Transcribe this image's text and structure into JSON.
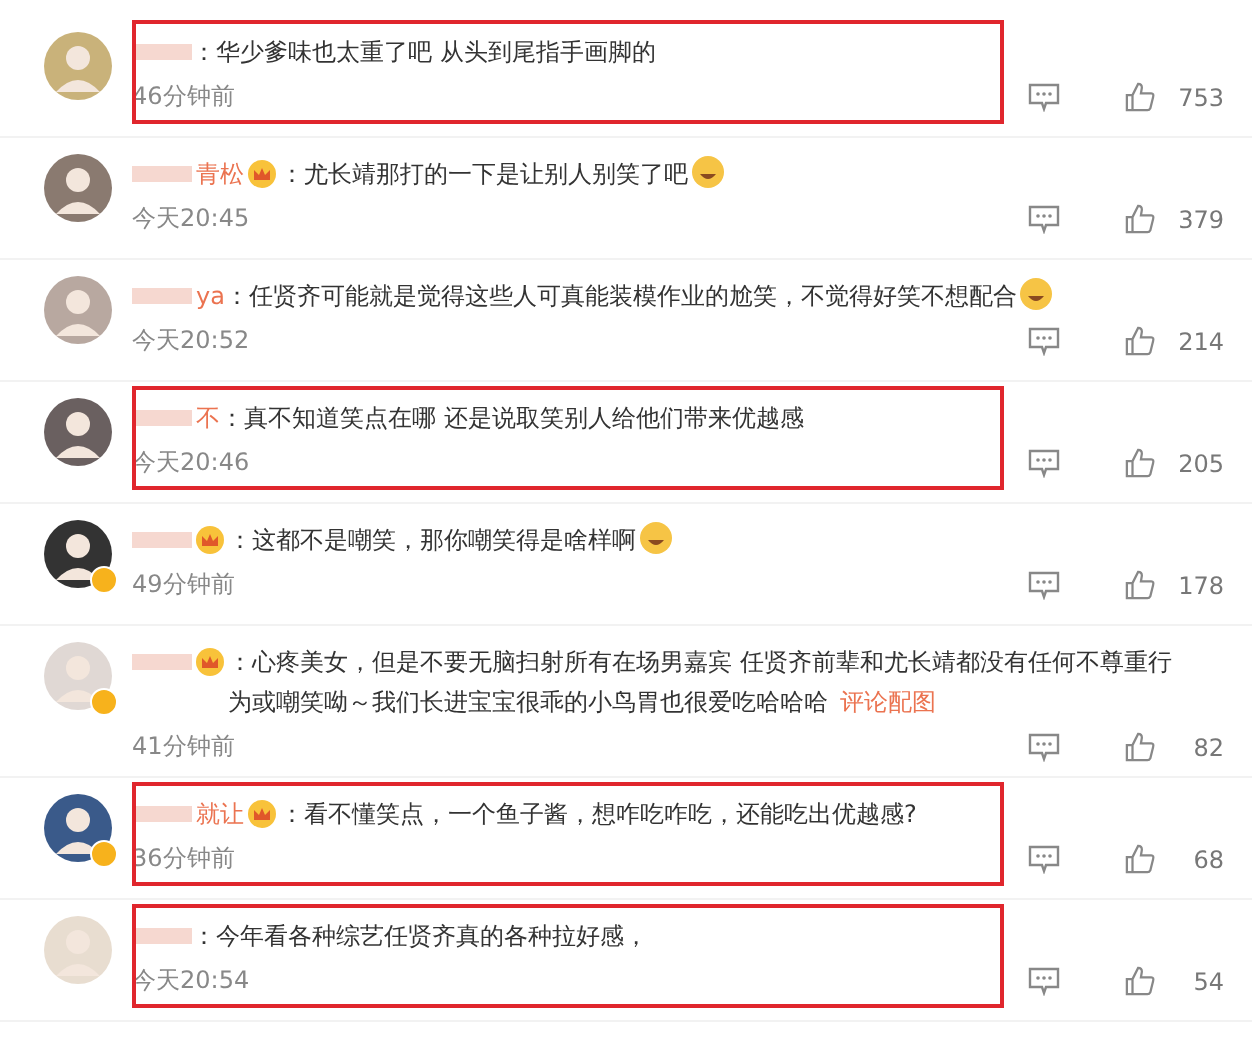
{
  "comments": [
    {
      "crown": false,
      "verified": false,
      "text": "：华少爹味也太重了吧 从头到尾指手画脚的",
      "emoji": false,
      "time": "46分钟前",
      "likes": "753",
      "highlighted": true
    },
    {
      "name": "青松",
      "crown": true,
      "verified": false,
      "text": "：尤长靖那打的一下是让别人别笑了吧",
      "emoji": true,
      "time": "今天20:45",
      "likes": "379",
      "highlighted": false
    },
    {
      "name": "ya",
      "crown": false,
      "verified": false,
      "text": "：任贤齐可能就是觉得这些人可真能装模作业的尬笑，不觉得好笑不想配合",
      "emoji": true,
      "time": "今天20:52",
      "likes": "214",
      "highlighted": false
    },
    {
      "name": "不",
      "crown": false,
      "verified": false,
      "text": "：真不知道笑点在哪 还是说取笑别人给他们带来优越感",
      "emoji": false,
      "time": "今天20:46",
      "likes": "205",
      "highlighted": true
    },
    {
      "crown": true,
      "verified": true,
      "text": "：这都不是嘲笑，那你嘲笑得是啥样啊",
      "emoji": true,
      "time": "49分钟前",
      "likes": "178",
      "highlighted": false
    },
    {
      "crown": true,
      "verified": true,
      "text": "：心疼美女，但是不要无脑扫射所有在场男嘉宾 任贤齐前辈和尤长靖都没有任何不尊重行为或嘲笑呦～我们长进宝宝很乖的小鸟胃也很爱吃哈哈哈",
      "emoji": false,
      "link": "评论配图",
      "time": "41分钟前",
      "likes": "82",
      "highlighted": false
    },
    {
      "name": "就让",
      "crown": true,
      "verified": true,
      "text": "：看不懂笑点，一个鱼子酱，想咋吃咋吃，还能吃出优越感?",
      "emoji": false,
      "time": "36分钟前",
      "likes": "68",
      "highlighted": true
    },
    {
      "crown": false,
      "verified": false,
      "text": "：今年看各种综艺任贤齐真的各种拉好感，",
      "emoji": false,
      "time": "今天20:54",
      "likes": "54",
      "highlighted": true
    }
  ]
}
